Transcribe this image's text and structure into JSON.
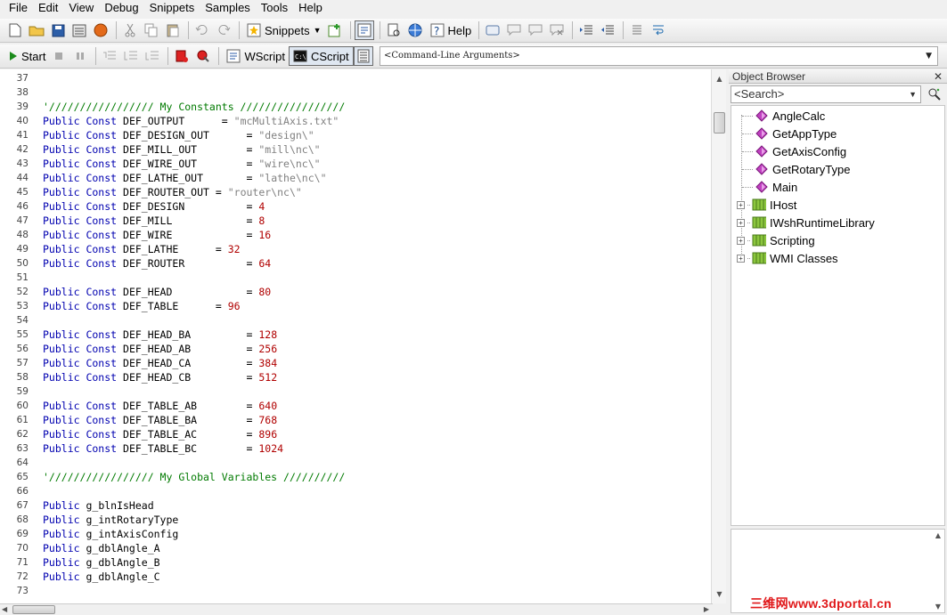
{
  "menu": [
    "File",
    "Edit",
    "View",
    "Debug",
    "Snippets",
    "Samples",
    "Tools",
    "Help"
  ],
  "toolbar1": {
    "snippets_label": "Snippets",
    "help_label": "Help"
  },
  "toolbar2": {
    "start_label": "Start",
    "wscript_label": "WScript",
    "cscript_label": "CScript",
    "cmd_args": "<Command-Line Arguments>"
  },
  "code_lines": [
    {
      "n": "37",
      "tokens": []
    },
    {
      "n": "38",
      "tokens": []
    },
    {
      "n": "39",
      "tokens": [
        {
          "t": "'///////////////// My Constants /////////////////",
          "c": "cm"
        }
      ]
    },
    {
      "n": "40",
      "tokens": [
        {
          "t": "Public Const",
          "c": "kw"
        },
        {
          "t": " DEF_OUTPUT      = ",
          "c": "plain"
        },
        {
          "t": "\"mcMultiAxis.txt\"",
          "c": "str"
        }
      ]
    },
    {
      "n": "41",
      "tokens": [
        {
          "t": "Public Const",
          "c": "kw"
        },
        {
          "t": " DEF_DESIGN_OUT      = ",
          "c": "plain"
        },
        {
          "t": "\"design\\\"",
          "c": "str"
        }
      ]
    },
    {
      "n": "42",
      "tokens": [
        {
          "t": "Public Const",
          "c": "kw"
        },
        {
          "t": " DEF_MILL_OUT        = ",
          "c": "plain"
        },
        {
          "t": "\"mill\\nc\\\"",
          "c": "str"
        }
      ]
    },
    {
      "n": "43",
      "tokens": [
        {
          "t": "Public Const",
          "c": "kw"
        },
        {
          "t": " DEF_WIRE_OUT        = ",
          "c": "plain"
        },
        {
          "t": "\"wire\\nc\\\"",
          "c": "str"
        }
      ]
    },
    {
      "n": "44",
      "tokens": [
        {
          "t": "Public Const",
          "c": "kw"
        },
        {
          "t": " DEF_LATHE_OUT       = ",
          "c": "plain"
        },
        {
          "t": "\"lathe\\nc\\\"",
          "c": "str"
        }
      ]
    },
    {
      "n": "45",
      "tokens": [
        {
          "t": "Public Const",
          "c": "kw"
        },
        {
          "t": " DEF_ROUTER_OUT = ",
          "c": "plain"
        },
        {
          "t": "\"router\\nc\\\"",
          "c": "str"
        }
      ]
    },
    {
      "n": "46",
      "tokens": [
        {
          "t": "Public Const",
          "c": "kw"
        },
        {
          "t": " DEF_DESIGN          = ",
          "c": "plain"
        },
        {
          "t": "4",
          "c": "num"
        }
      ]
    },
    {
      "n": "47",
      "tokens": [
        {
          "t": "Public Const",
          "c": "kw"
        },
        {
          "t": " DEF_MILL            = ",
          "c": "plain"
        },
        {
          "t": "8",
          "c": "num"
        }
      ]
    },
    {
      "n": "48",
      "tokens": [
        {
          "t": "Public Const",
          "c": "kw"
        },
        {
          "t": " DEF_WIRE            = ",
          "c": "plain"
        },
        {
          "t": "16",
          "c": "num"
        }
      ]
    },
    {
      "n": "49",
      "tokens": [
        {
          "t": "Public Const",
          "c": "kw"
        },
        {
          "t": " DEF_LATHE      = ",
          "c": "plain"
        },
        {
          "t": "32",
          "c": "num"
        }
      ]
    },
    {
      "n": "50",
      "tokens": [
        {
          "t": "Public Const",
          "c": "kw"
        },
        {
          "t": " DEF_ROUTER          = ",
          "c": "plain"
        },
        {
          "t": "64",
          "c": "num"
        }
      ]
    },
    {
      "n": "51",
      "tokens": []
    },
    {
      "n": "52",
      "tokens": [
        {
          "t": "Public Const",
          "c": "kw"
        },
        {
          "t": " DEF_HEAD            = ",
          "c": "plain"
        },
        {
          "t": "80",
          "c": "num"
        }
      ]
    },
    {
      "n": "53",
      "tokens": [
        {
          "t": "Public Const",
          "c": "kw"
        },
        {
          "t": " DEF_TABLE      = ",
          "c": "plain"
        },
        {
          "t": "96",
          "c": "num"
        }
      ]
    },
    {
      "n": "54",
      "tokens": []
    },
    {
      "n": "55",
      "tokens": [
        {
          "t": "Public Const",
          "c": "kw"
        },
        {
          "t": " DEF_HEAD_BA         = ",
          "c": "plain"
        },
        {
          "t": "128",
          "c": "num"
        }
      ]
    },
    {
      "n": "56",
      "tokens": [
        {
          "t": "Public Const",
          "c": "kw"
        },
        {
          "t": " DEF_HEAD_AB         = ",
          "c": "plain"
        },
        {
          "t": "256",
          "c": "num"
        }
      ]
    },
    {
      "n": "57",
      "tokens": [
        {
          "t": "Public Const",
          "c": "kw"
        },
        {
          "t": " DEF_HEAD_CA         = ",
          "c": "plain"
        },
        {
          "t": "384",
          "c": "num"
        }
      ]
    },
    {
      "n": "58",
      "tokens": [
        {
          "t": "Public Const",
          "c": "kw"
        },
        {
          "t": " DEF_HEAD_CB         = ",
          "c": "plain"
        },
        {
          "t": "512",
          "c": "num"
        }
      ]
    },
    {
      "n": "59",
      "tokens": []
    },
    {
      "n": "60",
      "tokens": [
        {
          "t": "Public Const",
          "c": "kw"
        },
        {
          "t": " DEF_TABLE_AB        = ",
          "c": "plain"
        },
        {
          "t": "640",
          "c": "num"
        }
      ]
    },
    {
      "n": "61",
      "tokens": [
        {
          "t": "Public Const",
          "c": "kw"
        },
        {
          "t": " DEF_TABLE_BA        = ",
          "c": "plain"
        },
        {
          "t": "768",
          "c": "num"
        }
      ]
    },
    {
      "n": "62",
      "tokens": [
        {
          "t": "Public Const",
          "c": "kw"
        },
        {
          "t": " DEF_TABLE_AC        = ",
          "c": "plain"
        },
        {
          "t": "896",
          "c": "num"
        }
      ]
    },
    {
      "n": "63",
      "tokens": [
        {
          "t": "Public Const",
          "c": "kw"
        },
        {
          "t": " DEF_TABLE_BC        = ",
          "c": "plain"
        },
        {
          "t": "1024",
          "c": "num"
        }
      ]
    },
    {
      "n": "64",
      "tokens": []
    },
    {
      "n": "65",
      "tokens": [
        {
          "t": "'///////////////// My Global Variables //////////",
          "c": "cm"
        }
      ]
    },
    {
      "n": "66",
      "tokens": []
    },
    {
      "n": "67",
      "tokens": [
        {
          "t": "Public",
          "c": "kw"
        },
        {
          "t": " g_blnIsHead",
          "c": "plain"
        }
      ]
    },
    {
      "n": "68",
      "tokens": [
        {
          "t": "Public",
          "c": "kw"
        },
        {
          "t": " g_intRotaryType",
          "c": "plain"
        }
      ]
    },
    {
      "n": "69",
      "tokens": [
        {
          "t": "Public",
          "c": "kw"
        },
        {
          "t": " g_intAxisConfig",
          "c": "plain"
        }
      ]
    },
    {
      "n": "70",
      "tokens": [
        {
          "t": "Public",
          "c": "kw"
        },
        {
          "t": " g_dblAngle_A",
          "c": "plain"
        }
      ]
    },
    {
      "n": "71",
      "tokens": [
        {
          "t": "Public",
          "c": "kw"
        },
        {
          "t": " g_dblAngle_B",
          "c": "plain"
        }
      ]
    },
    {
      "n": "72",
      "tokens": [
        {
          "t": "Public",
          "c": "kw"
        },
        {
          "t": " g_dblAngle_C",
          "c": "plain"
        }
      ]
    },
    {
      "n": "73",
      "tokens": []
    }
  ],
  "object_browser": {
    "title": "Object Browser",
    "search_placeholder": "<Search>",
    "items": [
      {
        "label": "AngleCalc",
        "kind": "method"
      },
      {
        "label": "GetAppType",
        "kind": "method"
      },
      {
        "label": "GetAxisConfig",
        "kind": "method"
      },
      {
        "label": "GetRotaryType",
        "kind": "method"
      },
      {
        "label": "Main",
        "kind": "method"
      },
      {
        "label": "IHost",
        "kind": "library"
      },
      {
        "label": "IWshRuntimeLibrary",
        "kind": "library"
      },
      {
        "label": "Scripting",
        "kind": "library"
      },
      {
        "label": "WMI Classes",
        "kind": "library"
      }
    ]
  },
  "watermark": "三维网www.3dportal.cn",
  "colors": {
    "keyword": "#0000b0",
    "comment": "#007a00",
    "number": "#b00000",
    "string": "#808080"
  }
}
